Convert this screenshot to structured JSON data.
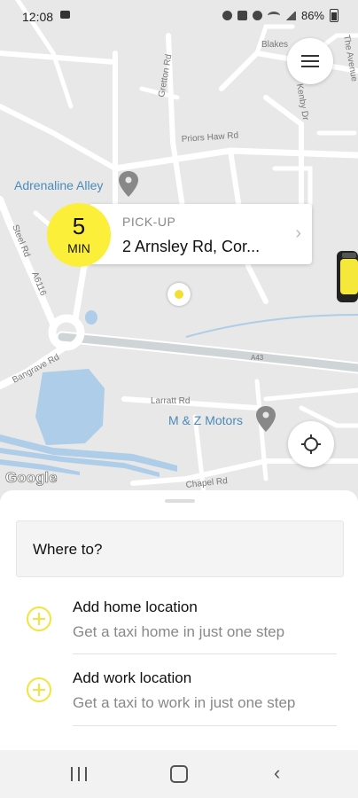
{
  "status_bar": {
    "time": "12:08",
    "battery": "86%"
  },
  "map": {
    "street_labels": {
      "blakes": "Blakes",
      "the_avenue": "The Avenue",
      "gretton": "Gretton Rd",
      "kenby": "Kenby Dr",
      "priors_haw": "Priors Haw Rd",
      "steel": "Steel Rd",
      "a6116": "A6116",
      "bangrave": "Bangrave Rd",
      "a43": "A43",
      "larratt": "Larratt Rd",
      "chapel": "Chapel Rd"
    },
    "places": {
      "adrenaline_alley": "Adrenaline Alley",
      "mz_motors": "M & Z Motors"
    },
    "attribution": "Google",
    "colors": {
      "background": "#e8e8e8",
      "roads": "#ffffff",
      "water": "#aecde8",
      "pin_accent": "#f2e030"
    }
  },
  "pickup": {
    "eta_number": "5",
    "eta_unit": "MIN",
    "label": "PICK-UP",
    "address": "2 Arnsley Rd, Cor..."
  },
  "sheet": {
    "where_to": "Where to?",
    "home": {
      "title": "Add home location",
      "subtitle": "Get a taxi home in just one step"
    },
    "work": {
      "title": "Add work location",
      "subtitle": "Get a taxi to work in just one step"
    },
    "accent_color": "#f2e43a"
  },
  "icons": {
    "menu": "hamburger-icon",
    "locate": "crosshair-icon",
    "add": "plus-circle-icon",
    "poi": "map-pin-icon",
    "taxi": "taxi-car-icon"
  }
}
